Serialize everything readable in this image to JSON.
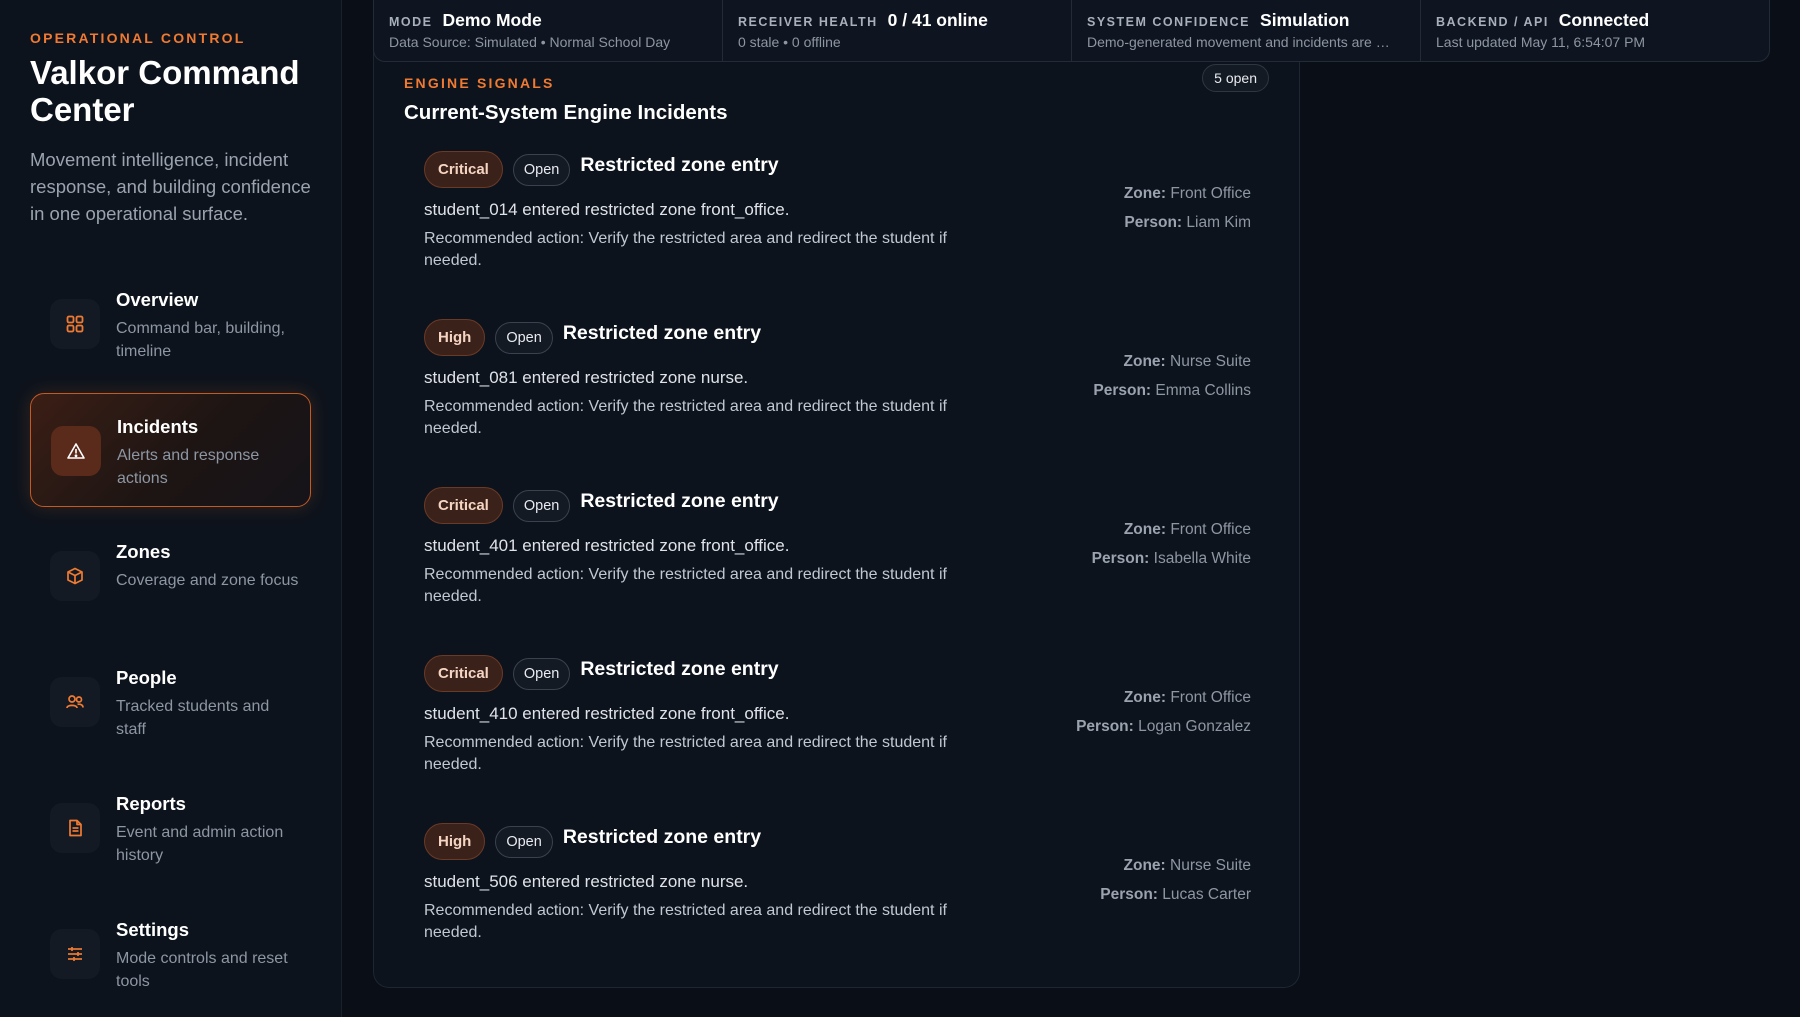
{
  "sidebar": {
    "eyebrow": "OPERATIONAL CONTROL",
    "title": "Valkor Command Center",
    "description": "Movement intelligence, incident response, and building confidence in one operational surface.",
    "accent": "#f07a32",
    "items": [
      {
        "label": "Overview",
        "sub": "Command bar, building, timeline",
        "icon": "grid-icon",
        "active": false
      },
      {
        "label": "Incidents",
        "sub": "Alerts and response actions",
        "icon": "warning-icon",
        "active": true
      },
      {
        "label": "Zones",
        "sub": "Coverage and zone focus",
        "icon": "cube-icon",
        "active": false
      },
      {
        "label": "People",
        "sub": "Tracked students and staff",
        "icon": "people-icon",
        "active": false
      },
      {
        "label": "Reports",
        "sub": "Event and admin action history",
        "icon": "document-icon",
        "active": false
      },
      {
        "label": "Settings",
        "sub": "Mode controls and reset tools",
        "icon": "sliders-icon",
        "active": false
      }
    ]
  },
  "status": {
    "mode": {
      "key": "MODE",
      "value": "Demo Mode",
      "sub": "Data Source: Simulated • Normal School Day"
    },
    "receiver": {
      "key": "RECEIVER HEALTH",
      "value": "0 / 41 online",
      "sub": "0 stale • 0 offline"
    },
    "confidence": {
      "key": "SYSTEM CONFIDENCE",
      "value": "Simulation",
      "sub": "Demo-generated movement and incidents are …"
    },
    "backend": {
      "key": "BACKEND / API",
      "value": "Connected",
      "sub": "Last updated May 11, 6:54:07 PM"
    }
  },
  "panel": {
    "eyebrow": "ENGINE SIGNALS",
    "title": "Current-System Engine Incidents",
    "count": "5 open",
    "zone_label": "Zone:",
    "person_label": "Person:",
    "incidents": [
      {
        "severity": "Critical",
        "state": "Open",
        "title": "Restricted zone entry",
        "desc": "student_014 entered restricted zone front_office.",
        "action": "Recommended action: Verify the restricted area and redirect the student if needed.",
        "zone": "Front Office",
        "person": "Liam Kim"
      },
      {
        "severity": "High",
        "state": "Open",
        "title": "Restricted zone entry",
        "desc": "student_081 entered restricted zone nurse.",
        "action": "Recommended action: Verify the restricted area and redirect the student if needed.",
        "zone": "Nurse Suite",
        "person": "Emma Collins"
      },
      {
        "severity": "Critical",
        "state": "Open",
        "title": "Restricted zone entry",
        "desc": "student_401 entered restricted zone front_office.",
        "action": "Recommended action: Verify the restricted area and redirect the student if needed.",
        "zone": "Front Office",
        "person": "Isabella White"
      },
      {
        "severity": "Critical",
        "state": "Open",
        "title": "Restricted zone entry",
        "desc": "student_410 entered restricted zone front_office.",
        "action": "Recommended action: Verify the restricted area and redirect the student if needed.",
        "zone": "Front Office",
        "person": "Logan Gonzalez"
      },
      {
        "severity": "High",
        "state": "Open",
        "title": "Restricted zone entry",
        "desc": "student_506 entered restricted zone nurse.",
        "action": "Recommended action: Verify the restricted area and redirect the student if needed.",
        "zone": "Nurse Suite",
        "person": "Lucas Carter"
      }
    ]
  }
}
